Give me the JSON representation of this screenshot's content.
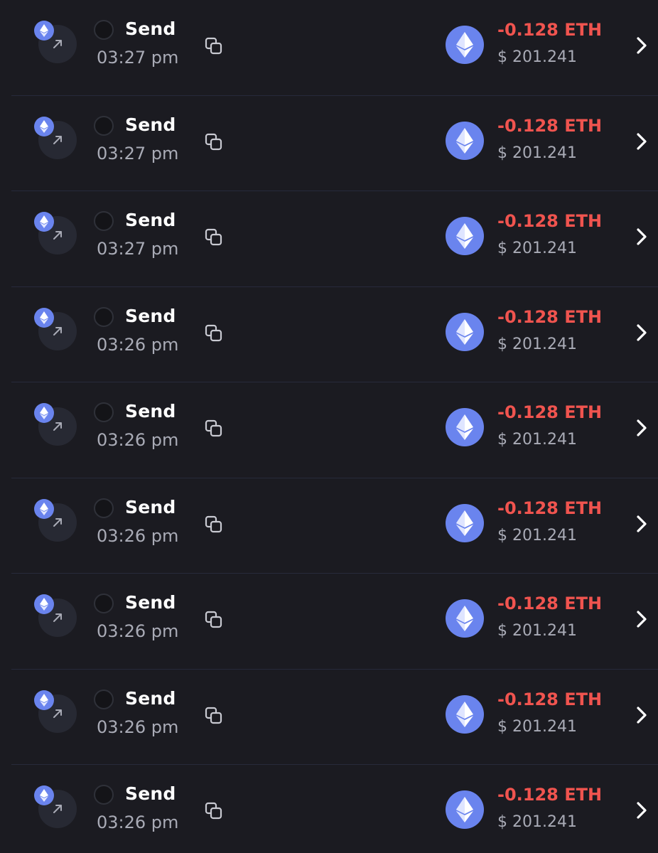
{
  "colors": {
    "background": "#1b1b21",
    "divider": "#272a3b",
    "eth_blue": "#6a84ee",
    "amount_negative": "#f0544f",
    "secondary_text": "#a9abb6"
  },
  "icons": {
    "type": "arrow-up-right-icon",
    "chain": "ethereum-icon",
    "copy": "copy-icon",
    "asset": "ethereum-icon",
    "chevron": "chevron-right-icon"
  },
  "transactions": [
    {
      "type": "Send",
      "time": "03:27 pm",
      "amount": "-0.128 ETH",
      "fiat": "$ 201.241"
    },
    {
      "type": "Send",
      "time": "03:27 pm",
      "amount": "-0.128 ETH",
      "fiat": "$ 201.241"
    },
    {
      "type": "Send",
      "time": "03:27 pm",
      "amount": "-0.128 ETH",
      "fiat": "$ 201.241"
    },
    {
      "type": "Send",
      "time": "03:26 pm",
      "amount": "-0.128 ETH",
      "fiat": "$ 201.241"
    },
    {
      "type": "Send",
      "time": "03:26 pm",
      "amount": "-0.128 ETH",
      "fiat": "$ 201.241"
    },
    {
      "type": "Send",
      "time": "03:26 pm",
      "amount": "-0.128 ETH",
      "fiat": "$ 201.241"
    },
    {
      "type": "Send",
      "time": "03:26 pm",
      "amount": "-0.128 ETH",
      "fiat": "$ 201.241"
    },
    {
      "type": "Send",
      "time": "03:26 pm",
      "amount": "-0.128 ETH",
      "fiat": "$ 201.241"
    },
    {
      "type": "Send",
      "time": "03:26 pm",
      "amount": "-0.128 ETH",
      "fiat": "$ 201.241"
    }
  ]
}
